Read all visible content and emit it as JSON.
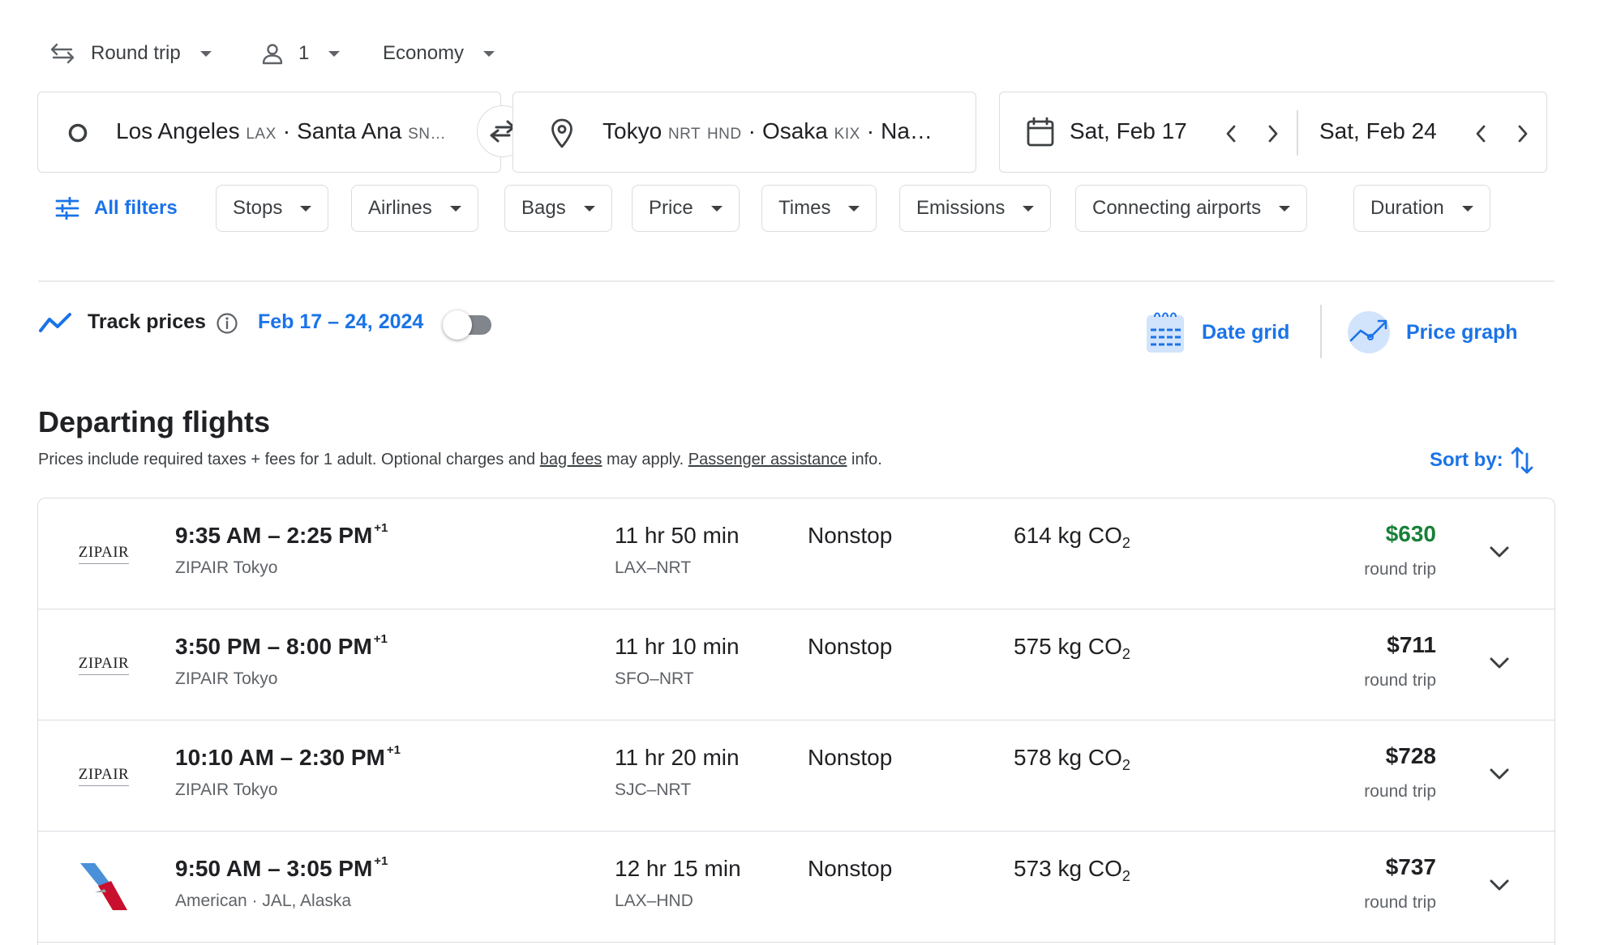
{
  "trip_options": {
    "trip_type": "Round trip",
    "passengers": "1",
    "cabin": "Economy"
  },
  "search": {
    "origin": {
      "city1": "Los Angeles",
      "code1": "LAX",
      "city2": "Santa Ana",
      "code2": "SN…"
    },
    "destination": {
      "city1": "Tokyo",
      "code1a": "NRT",
      "code1b": "HND",
      "city2": "Osaka",
      "code2": "KIX",
      "city3": "Na…"
    },
    "separator": "·",
    "depart_date": "Sat, Feb 17",
    "return_date": "Sat, Feb 24"
  },
  "filters": {
    "all_filters": "All filters",
    "chips": [
      "Stops",
      "Airlines",
      "Bags",
      "Price",
      "Times",
      "Emissions",
      "Connecting airports",
      "Duration"
    ]
  },
  "track": {
    "label": "Track prices",
    "dates": "Feb 17 – 24, 2024",
    "enabled": false
  },
  "views": {
    "date_grid": "Date grid",
    "price_graph": "Price graph"
  },
  "section": {
    "title": "Departing flights",
    "sub_pre": "Prices include required taxes + fees for 1 adult. Optional charges and ",
    "bag_fees": "bag fees",
    "sub_mid": " may apply. ",
    "passenger_assistance": "Passenger assistance",
    "sub_post": " info.",
    "sort_by": "Sort by:"
  },
  "flights": [
    {
      "logo": "ZIPAIR",
      "depart": "9:35 AM",
      "arrive": "2:25 PM",
      "day_offset": "+1",
      "carrier": "ZIPAIR Tokyo",
      "duration": "11 hr 50 min",
      "route": "LAX–NRT",
      "stops": "Nonstop",
      "emissions": "614 kg CO",
      "price": "$630",
      "price_type": "round trip",
      "best": true
    },
    {
      "logo": "ZIPAIR",
      "depart": "3:50 PM",
      "arrive": "8:00 PM",
      "day_offset": "+1",
      "carrier": "ZIPAIR Tokyo",
      "duration": "11 hr 10 min",
      "route": "SFO–NRT",
      "stops": "Nonstop",
      "emissions": "575 kg CO",
      "price": "$711",
      "price_type": "round trip",
      "best": false
    },
    {
      "logo": "ZIPAIR",
      "depart": "10:10 AM",
      "arrive": "2:30 PM",
      "day_offset": "+1",
      "carrier": "ZIPAIR Tokyo",
      "duration": "11 hr 20 min",
      "route": "SJC–NRT",
      "stops": "Nonstop",
      "emissions": "578 kg CO",
      "price": "$728",
      "price_type": "round trip",
      "best": false
    },
    {
      "logo": "American",
      "depart": "9:50 AM",
      "arrive": "3:05 PM",
      "day_offset": "+1",
      "carrier": "American · JAL, Alaska",
      "duration": "12 hr 15 min",
      "route": "LAX–HND",
      "stops": "Nonstop",
      "emissions": "573 kg CO",
      "price": "$737",
      "price_type": "round trip",
      "best": false
    }
  ],
  "emissions_subscript": "2",
  "colors": {
    "accent": "#1a73e8",
    "best_price": "#188038",
    "border": "#dadce0",
    "secondary_text": "#5f6368"
  }
}
